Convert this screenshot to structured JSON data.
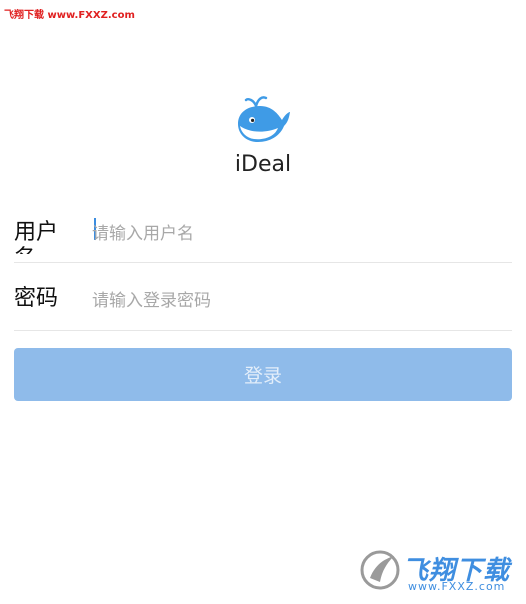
{
  "watermark": {
    "top_text": "飞翔下载 www.FXXZ.com"
  },
  "app": {
    "name": "iDeal",
    "logo_icon": "whale-icon",
    "logo_color": "#3f9be6"
  },
  "form": {
    "username": {
      "label": "用户名",
      "placeholder": "请输入用户名",
      "value": ""
    },
    "password": {
      "label": "密码",
      "placeholder": "请输入登录密码",
      "value": ""
    }
  },
  "login_button": {
    "label": "登录",
    "color": "#8fbbea"
  },
  "badge": {
    "title": "飞翔下载",
    "url": "www.FXXZ.com",
    "icon": "fxxz-logo-icon"
  }
}
